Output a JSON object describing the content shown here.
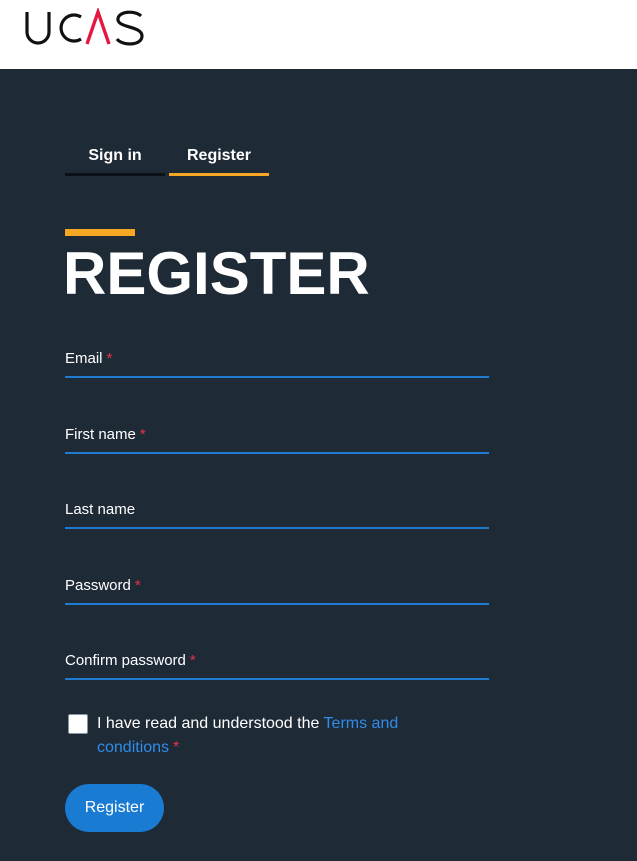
{
  "header": {
    "logo_text": "UCAS"
  },
  "tabs": [
    {
      "label": "Sign in",
      "active": false
    },
    {
      "label": "Register",
      "active": true
    }
  ],
  "page": {
    "title": "REGISTER"
  },
  "form": {
    "fields": [
      {
        "label": "Email",
        "required_mark": "*",
        "value": ""
      },
      {
        "label": "First name",
        "required_mark": "*",
        "value": ""
      },
      {
        "label": "Last name",
        "required_mark": "",
        "value": ""
      },
      {
        "label": "Password",
        "required_mark": "*",
        "value": ""
      },
      {
        "label": "Confirm password",
        "required_mark": "*",
        "value": ""
      }
    ],
    "terms": {
      "text": "I have read and understood the ",
      "link_text_1": "Terms and",
      "link_text_2": "conditions",
      "required_mark": "*",
      "checked": false
    },
    "submit_label": "Register"
  },
  "colors": {
    "background": "#1f2a37",
    "accent": "#f5a623",
    "link": "#2f8ce8",
    "primary_button": "#1a7bd3",
    "required": "#e0334d"
  }
}
